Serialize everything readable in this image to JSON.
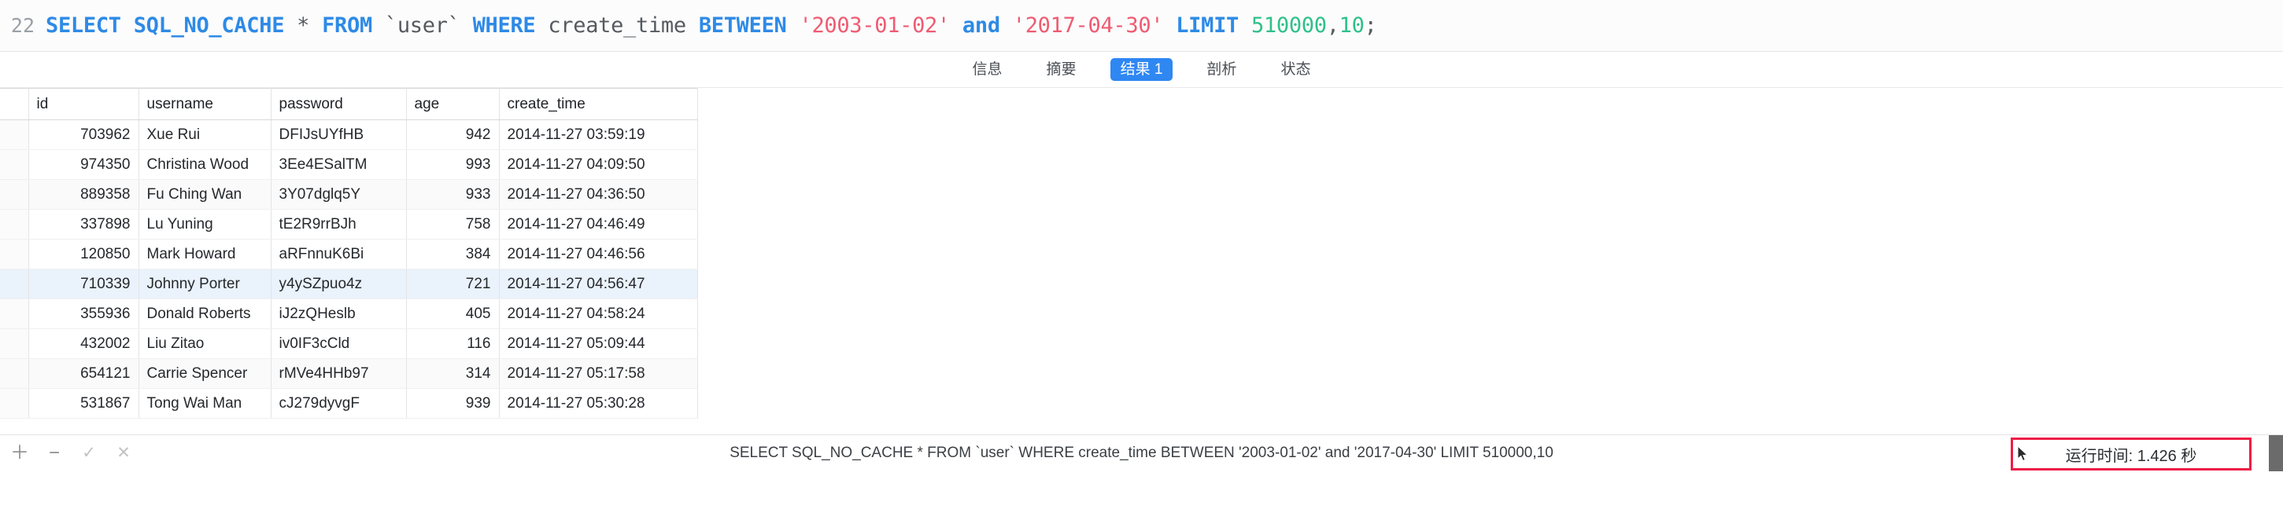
{
  "editor": {
    "line_number": "22",
    "tokens": [
      {
        "t": "SELECT",
        "c": "kw"
      },
      {
        "t": " ",
        "c": "plain"
      },
      {
        "t": "SQL_NO_CACHE",
        "c": "kw"
      },
      {
        "t": " ",
        "c": "plain"
      },
      {
        "t": "*",
        "c": "star"
      },
      {
        "t": " ",
        "c": "plain"
      },
      {
        "t": "FROM",
        "c": "kw"
      },
      {
        "t": " ",
        "c": "plain"
      },
      {
        "t": "`user`",
        "c": "ident"
      },
      {
        "t": " ",
        "c": "plain"
      },
      {
        "t": "WHERE",
        "c": "kw"
      },
      {
        "t": " ",
        "c": "plain"
      },
      {
        "t": "create_time",
        "c": "ident"
      },
      {
        "t": " ",
        "c": "plain"
      },
      {
        "t": "BETWEEN",
        "c": "kw"
      },
      {
        "t": " ",
        "c": "plain"
      },
      {
        "t": "'2003-01-02'",
        "c": "str"
      },
      {
        "t": " ",
        "c": "plain"
      },
      {
        "t": "and",
        "c": "kw"
      },
      {
        "t": " ",
        "c": "plain"
      },
      {
        "t": "'2017-04-30'",
        "c": "str"
      },
      {
        "t": " ",
        "c": "plain"
      },
      {
        "t": "LIMIT",
        "c": "kw"
      },
      {
        "t": " ",
        "c": "plain"
      },
      {
        "t": "510000",
        "c": "num"
      },
      {
        "t": ",",
        "c": "punct"
      },
      {
        "t": "10",
        "c": "num"
      },
      {
        "t": ";",
        "c": "punct"
      }
    ],
    "full_text": "SELECT SQL_NO_CACHE * FROM `user` WHERE create_time BETWEEN '2003-01-02' and '2017-04-30' LIMIT 510000,10;"
  },
  "tabs": [
    {
      "label": "信息",
      "active": false
    },
    {
      "label": "摘要",
      "active": false
    },
    {
      "label": "结果 1",
      "active": true
    },
    {
      "label": "剖析",
      "active": false
    },
    {
      "label": "状态",
      "active": false
    }
  ],
  "grid": {
    "columns": [
      "id",
      "username",
      "password",
      "age",
      "create_time"
    ],
    "rows": [
      {
        "id": "703962",
        "username": "Xue Rui",
        "password": "DFIJsUYfHB",
        "age": "942",
        "create_time": "2014-11-27 03:59:19"
      },
      {
        "id": "974350",
        "username": "Christina Wood",
        "password": "3Ee4ESalTM",
        "age": "993",
        "create_time": "2014-11-27 04:09:50"
      },
      {
        "id": "889358",
        "username": "Fu Ching Wan",
        "password": "3Y07dglq5Y",
        "age": "933",
        "create_time": "2014-11-27 04:36:50"
      },
      {
        "id": "337898",
        "username": "Lu Yuning",
        "password": "tE2R9rrBJh",
        "age": "758",
        "create_time": "2014-11-27 04:46:49"
      },
      {
        "id": "120850",
        "username": "Mark Howard",
        "password": "aRFnnuK6Bi",
        "age": "384",
        "create_time": "2014-11-27 04:46:56"
      },
      {
        "id": "710339",
        "username": "Johnny Porter",
        "password": "y4ySZpuo4z",
        "age": "721",
        "create_time": "2014-11-27 04:56:47"
      },
      {
        "id": "355936",
        "username": "Donald Roberts",
        "password": "iJ2zQHeslb",
        "age": "405",
        "create_time": "2014-11-27 04:58:24"
      },
      {
        "id": "432002",
        "username": "Liu Zitao",
        "password": "iv0IF3cCld",
        "age": "116",
        "create_time": "2014-11-27 05:09:44"
      },
      {
        "id": "654121",
        "username": "Carrie Spencer",
        "password": "rMVe4HHb97",
        "age": "314",
        "create_time": "2014-11-27 05:17:58"
      },
      {
        "id": "531867",
        "username": "Tong Wai Man",
        "password": "cJ279dyvgF",
        "age": "939",
        "create_time": "2014-11-27 05:30:28"
      }
    ],
    "selected_row_index": 5,
    "striped_row_indices": [
      2,
      8
    ]
  },
  "statusbar": {
    "icons": [
      {
        "name": "add-row-icon",
        "glyph": "＋"
      },
      {
        "name": "remove-row-icon",
        "glyph": "−"
      },
      {
        "name": "confirm-icon",
        "glyph": "✓"
      },
      {
        "name": "cancel-icon",
        "glyph": "✕"
      }
    ],
    "sql": "SELECT SQL_NO_CACHE * FROM `user` WHERE create_time BETWEEN '2003-01-02' and '2017-04-30' LIMIT 510000,10",
    "runtime": "运行时间: 1.426 秒"
  },
  "colors": {
    "accent": "#2f87f2",
    "keyword": "#2e8ae6",
    "string": "#ef5b72",
    "number": "#2fc08b",
    "highlight_box": "#ee1c46",
    "selected_row": "#eaf2fb"
  }
}
